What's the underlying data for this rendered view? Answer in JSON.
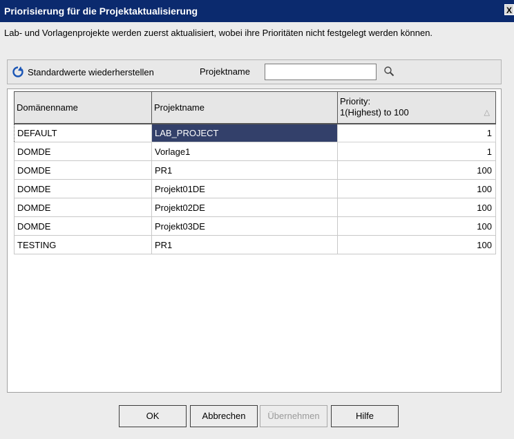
{
  "window": {
    "title": "Priorisierung für die Projektaktualisierung",
    "close_label": "X"
  },
  "info_text": "Lab- und Vorlagenprojekte werden zuerst aktualisiert, wobei ihre Prioritäten nicht festgelegt werden können.",
  "toolbar": {
    "restore_label": "Standardwerte wiederherstellen",
    "restore_icon": "refresh-icon",
    "project_name_label": "Projektname",
    "search_value": "",
    "search_icon": "magnifier-icon"
  },
  "table": {
    "headers": {
      "domain": "Domänenname",
      "project": "Projektname",
      "priority_line1": "Priority:",
      "priority_line2": "1(Highest) to 100",
      "sort_indicator": "△"
    },
    "rows": [
      {
        "domain": "DEFAULT",
        "project": "LAB_PROJECT",
        "priority": "1",
        "selected": true
      },
      {
        "domain": "DOMDE",
        "project": "Vorlage1",
        "priority": "1"
      },
      {
        "domain": "DOMDE",
        "project": "PR1",
        "priority": "100"
      },
      {
        "domain": "DOMDE",
        "project": "Projekt01DE",
        "priority": "100"
      },
      {
        "domain": "DOMDE",
        "project": "Projekt02DE",
        "priority": "100"
      },
      {
        "domain": "DOMDE",
        "project": "Projekt03DE",
        "priority": "100"
      },
      {
        "domain": "TESTING",
        "project": "PR1",
        "priority": "100"
      }
    ]
  },
  "buttons": {
    "ok": "OK",
    "cancel": "Abbrechen",
    "apply": "Übernehmen",
    "apply_disabled": true,
    "help": "Hilfe"
  },
  "colors": {
    "title_bar": "#0b2a6e",
    "selection": "#33406a",
    "background": "#ececec"
  }
}
